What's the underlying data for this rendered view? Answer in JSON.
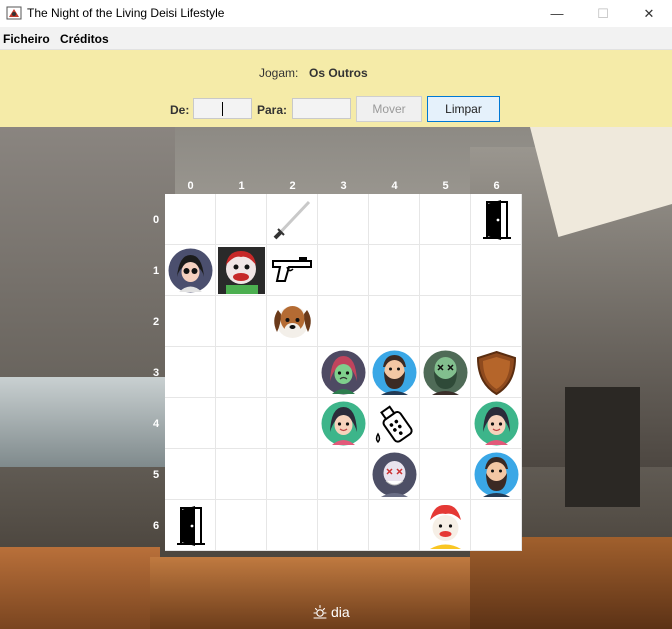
{
  "window": {
    "title": "The Night of the Living Deisi Lifestyle",
    "minimize": "—",
    "maximize": "☐",
    "close": "✕"
  },
  "menu": {
    "items": [
      "Ficheiro",
      "Créditos"
    ]
  },
  "status": {
    "players_label": "Jogam:",
    "players_value": "Os Outros"
  },
  "move_form": {
    "from_label": "De:",
    "from_value": "",
    "to_label": "Para:",
    "to_value": "",
    "move_button": "Mover",
    "clear_button": "Limpar"
  },
  "board": {
    "columns": [
      "0",
      "1",
      "2",
      "3",
      "4",
      "5",
      "6"
    ],
    "rows": [
      "0",
      "1",
      "2",
      "3",
      "4",
      "5",
      "6"
    ],
    "pieces": [
      {
        "row": 0,
        "col": 2,
        "icon": "sword-icon"
      },
      {
        "row": 0,
        "col": 6,
        "icon": "door-icon"
      },
      {
        "row": 1,
        "col": 0,
        "icon": "girl-sunglasses-avatar-icon"
      },
      {
        "row": 1,
        "col": 1,
        "icon": "clown-photo-icon"
      },
      {
        "row": 1,
        "col": 2,
        "icon": "pistol-icon"
      },
      {
        "row": 2,
        "col": 2,
        "icon": "dog-icon"
      },
      {
        "row": 3,
        "col": 3,
        "icon": "zombie-girl-avatar-icon"
      },
      {
        "row": 3,
        "col": 4,
        "icon": "bearded-man-avatar-icon"
      },
      {
        "row": 3,
        "col": 5,
        "icon": "zombie-man-avatar-icon"
      },
      {
        "row": 3,
        "col": 6,
        "icon": "shield-icon"
      },
      {
        "row": 4,
        "col": 3,
        "icon": "girl-avatar-icon"
      },
      {
        "row": 4,
        "col": 4,
        "icon": "spray-bottle-icon"
      },
      {
        "row": 4,
        "col": 6,
        "icon": "girl-avatar-icon"
      },
      {
        "row": 5,
        "col": 4,
        "icon": "zombie-old-man-avatar-icon"
      },
      {
        "row": 5,
        "col": 6,
        "icon": "bearded-man-avatar-icon"
      },
      {
        "row": 6,
        "col": 0,
        "icon": "door-icon"
      },
      {
        "row": 6,
        "col": 5,
        "icon": "clown-avatar-icon"
      }
    ]
  },
  "cycle": {
    "icon": "sun-icon",
    "label": "dia"
  }
}
